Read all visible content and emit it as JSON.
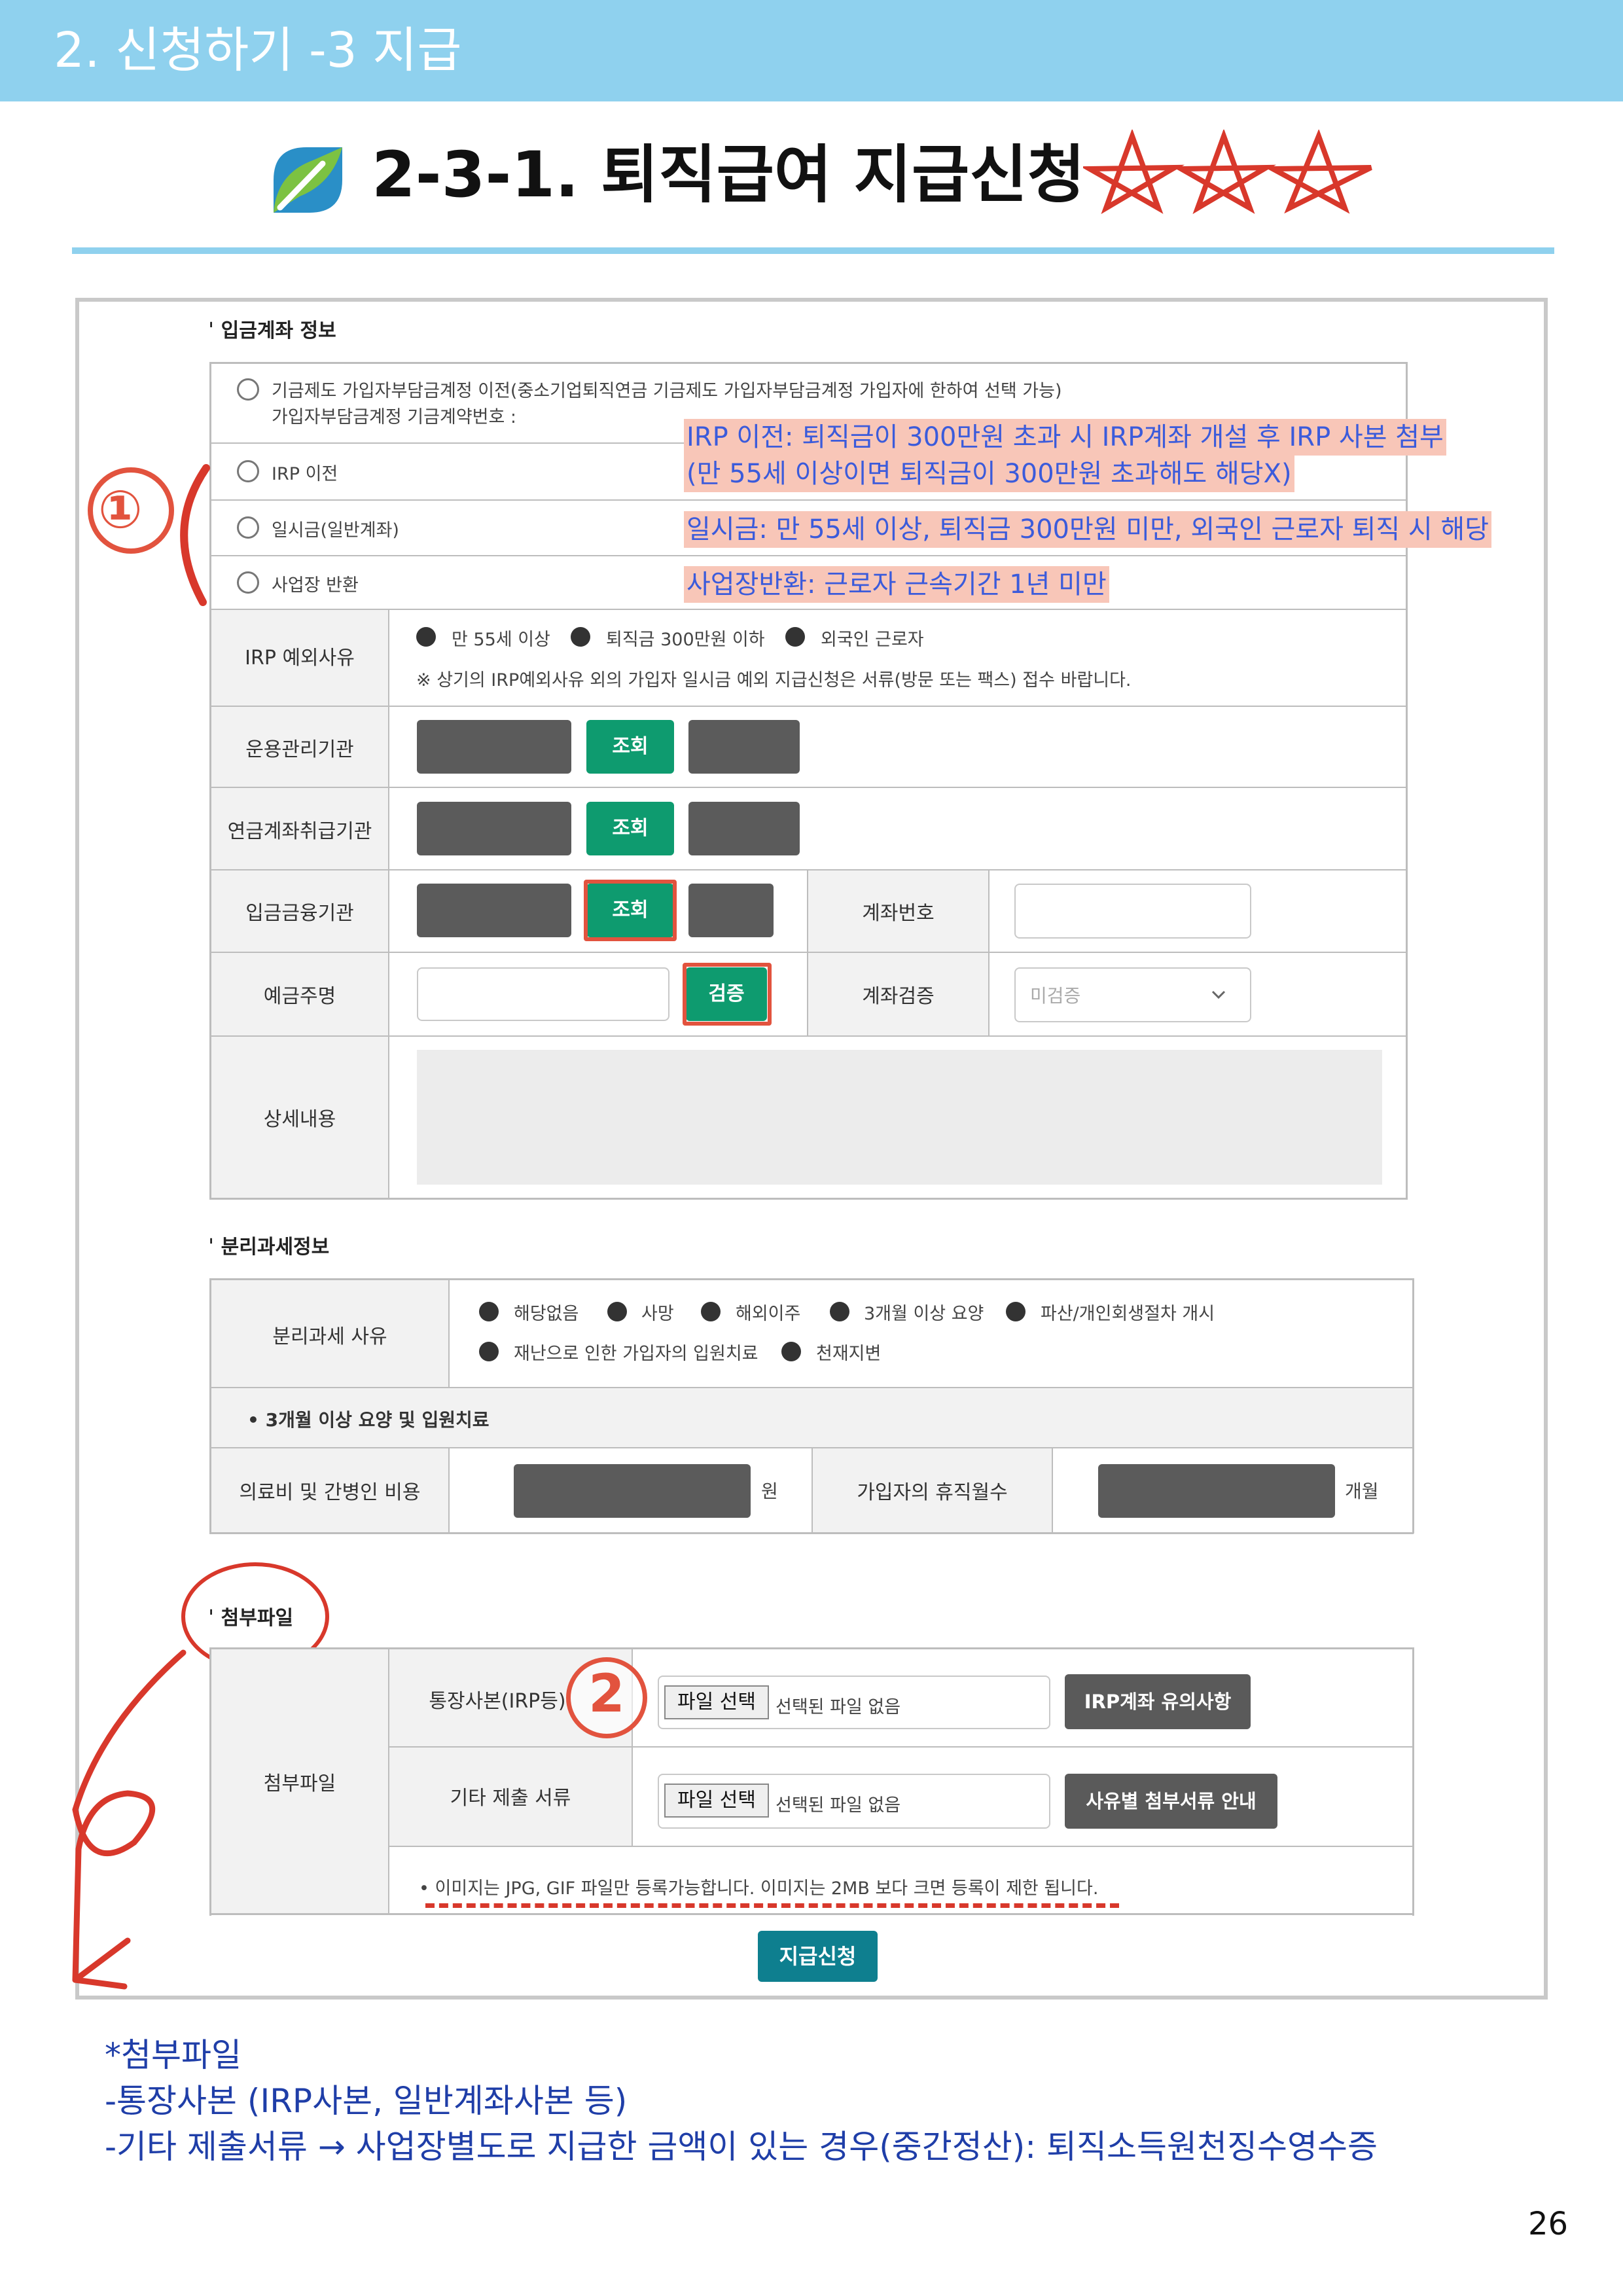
{
  "header": {
    "section": "2. 신청하기 -3 지급"
  },
  "title": {
    "text": "2-3-1. 퇴직급여 지급신청"
  },
  "form": {
    "deposit_section": "입금계좌 정보",
    "options": [
      {
        "line1": "기금제도 가입자부담금계정 이전(중소기업퇴직연금 기금제도 가입자부담금계정 가입자에 한하여 선택 가능)",
        "line2": "가입자부담금계정 기금계약번호 :"
      },
      {
        "line1": "IRP 이전"
      },
      {
        "line1": "일시금(일반계좌)"
      },
      {
        "line1": "사업장 반환"
      }
    ],
    "annotations": [
      "IRP 이전: 퇴직금이 300만원 초과 시 IRP계좌 개설 후 IRP 사본 첨부",
      "(만 55세 이상이면 퇴직금이 300만원 초과해도 해당X)",
      "일시금: 만 55세 이상, 퇴직금 300만원 미만, 외국인 근로자 퇴직 시 해당",
      "사업장반환: 근로자 근속기간 1년 미만"
    ],
    "circle1": "①",
    "circle2": "2",
    "irp_reason": {
      "label": "IRP 예외사유",
      "choices": [
        "만 55세 이상",
        "퇴직금 300만원 이하",
        "외국인 근로자"
      ],
      "note": "※ 상기의 IRP예외사유 외의 가입자 일시금 예외 지급신청은 서류(방문 또는 팩스) 접수 바랍니다."
    },
    "rows": {
      "manager": "운용관리기관",
      "pension": "연금계좌취급기관",
      "deposit_bank": "입금금융기관",
      "account_no": "계좌번호",
      "holder": "예금주명",
      "verify_label": "계좌검증",
      "verify_value": "미검증",
      "detail": "상세내용",
      "lookup": "조회",
      "verify_btn": "검증"
    },
    "tax_section": "분리과세정보",
    "tax": {
      "label": "분리과세 사유",
      "choices_row1": [
        "해당없음",
        "사망",
        "해외이주",
        "3개월 이상 요양",
        "파산/개인회생절차 개시"
      ],
      "choices_row2": [
        "재난으로 인한 가입자의 입원치료",
        "천재지변"
      ],
      "sub_heading": "• 3개월 이상 요양 및 입원치료",
      "medical": "의료비 및 간병인 비용",
      "won": "원",
      "leave": "가입자의 휴직월수",
      "months": "개월"
    },
    "attach_section": "첨부파일",
    "attach": {
      "label": "첨부파일",
      "bankbook": "통장사본(IRP등)",
      "other": "기타 제출 서류",
      "choose": "파일 선택",
      "none": "선택된 파일 없음",
      "irp_notice": "IRP계좌 유의사항",
      "guide": "사유별 첨부서류 안내",
      "note": "• 이미지는 JPG, GIF 파일만 등록가능합니다. 이미지는 2MB 보다 크면 등록이 제한 됩니다."
    },
    "submit": "지급신청"
  },
  "notes": [
    "*첨부파일",
    "-통장사본 (IRP사본, 일반계좌사본 등)",
    "-기타 제출서류 → 사업장별도로 지급한 금액이 있는 경우(중간정산): 퇴직소득원천징수영수증"
  ],
  "page_number": "26",
  "colors": {
    "banner": "#8fd1ee",
    "green": "#0e9b6f",
    "red": "#e2533e",
    "teal": "#0e7f8f",
    "note_blue": "#1f3ea8"
  }
}
